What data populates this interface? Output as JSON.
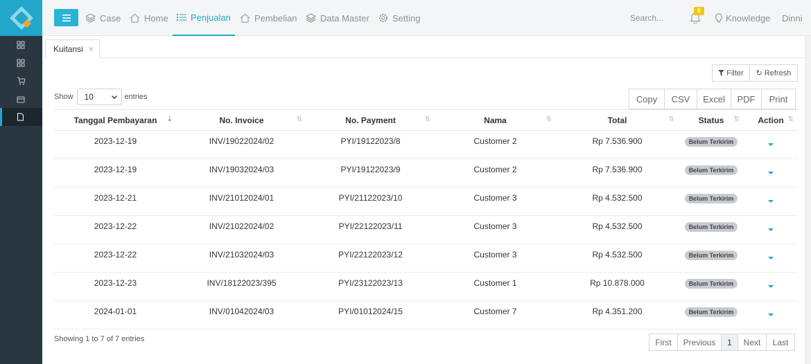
{
  "topbar": {
    "nav": [
      {
        "label": "Case",
        "icon": "layers-icon",
        "active": false
      },
      {
        "label": "Home",
        "icon": "home-icon",
        "active": false
      },
      {
        "label": "Penjualan",
        "icon": "list-icon",
        "active": true
      },
      {
        "label": "Pembelian",
        "icon": "home-icon",
        "active": false
      },
      {
        "label": "Data Master",
        "icon": "layers-icon",
        "active": false
      },
      {
        "label": "Setting",
        "icon": "gear-icon",
        "active": false
      }
    ],
    "search_placeholder": "Search...",
    "notification_count": "0",
    "knowledge_label": "Knowledge",
    "user_name": "Dinni"
  },
  "sidebar": {
    "items": [
      {
        "icon": "dashboard-icon",
        "active": false
      },
      {
        "icon": "dashboard-icon",
        "active": false
      },
      {
        "icon": "cart-icon",
        "active": false
      },
      {
        "icon": "wallet-icon",
        "active": false
      },
      {
        "icon": "document-icon",
        "active": true
      }
    ]
  },
  "page_tab": {
    "label": "Kuitansi",
    "close": "×"
  },
  "toolbar": {
    "filter_label": "Filter",
    "refresh_label": "Refresh"
  },
  "entries": {
    "show_label": "Show",
    "selected": "10",
    "suffix": "entries"
  },
  "export_buttons": [
    "Copy",
    "CSV",
    "Excel",
    "PDF",
    "Print"
  ],
  "table": {
    "columns": [
      "Tanggal Pembayaran",
      "No. Invoice",
      "No. Payment",
      "Nama",
      "Total",
      "Status",
      "Action"
    ],
    "rows": [
      {
        "tanggal": "2023-12-19",
        "invoice": "INV/19022024/02",
        "payment": "PYI/19122023/8",
        "nama": "Customer 2",
        "total": "Rp 7.536.900",
        "status": "Belum Terkirim"
      },
      {
        "tanggal": "2023-12-19",
        "invoice": "INV/19032024/03",
        "payment": "PYI/19122023/9",
        "nama": "Customer 2",
        "total": "Rp 7.536.900",
        "status": "Belum Terkirim"
      },
      {
        "tanggal": "2023-12-21",
        "invoice": "INV/21012024/01",
        "payment": "PYI/21122023/10",
        "nama": "Customer 3",
        "total": "Rp 4.532.500",
        "status": "Belum Terkirim"
      },
      {
        "tanggal": "2023-12-22",
        "invoice": "INV/21022024/02",
        "payment": "PYI/22122023/11",
        "nama": "Customer 3",
        "total": "Rp 4.532.500",
        "status": "Belum Terkirim"
      },
      {
        "tanggal": "2023-12-22",
        "invoice": "INV/21032024/03",
        "payment": "PYI/22122023/12",
        "nama": "Customer 3",
        "total": "Rp 4.532.500",
        "status": "Belum Terkirim"
      },
      {
        "tanggal": "2023-12-23",
        "invoice": "INV/18122023/395",
        "payment": "PYI/23122023/13",
        "nama": "Customer 1",
        "total": "Rp 10.878.000",
        "status": "Belum Terkirim"
      },
      {
        "tanggal": "2024-01-01",
        "invoice": "INV/01042024/03",
        "payment": "PYI/01012024/15",
        "nama": "Customer 7",
        "total": "Rp 4.351.200",
        "status": "Belum Terkirim"
      }
    ]
  },
  "footer": {
    "info": "Showing 1 to 7 of 7 entries",
    "pagination": [
      "First",
      "Previous",
      "1",
      "Next",
      "Last"
    ],
    "current_page": "1"
  },
  "colors": {
    "accent": "#22a6c9",
    "sidebar": "#2a3640",
    "badge": "#f2c811"
  }
}
